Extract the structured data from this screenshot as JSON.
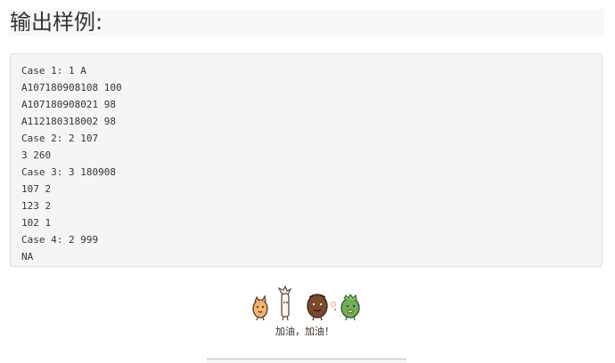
{
  "page": {
    "heading": "输出样例:"
  },
  "code_block": {
    "lines": [
      "Case 1: 1 A",
      "A107180908108 100",
      "A107180908021 98",
      "A112180318002 98",
      "Case 2: 2 107",
      "3 260",
      "Case 3: 3 180908",
      "107 2",
      "123 2",
      "102 1",
      "Case 4: 2 999",
      "NA"
    ]
  },
  "sticker": {
    "caption": "加油，加油！",
    "icon": "cheer-characters-illustration"
  },
  "colors": {
    "heading_bg": "#f7f7f7",
    "code_bg": "#f5f5f5",
    "code_border": "#e1e1e1",
    "text": "#333333"
  }
}
